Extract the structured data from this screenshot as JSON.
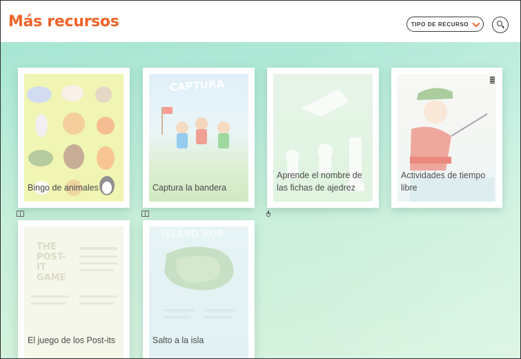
{
  "header": {
    "title": "Más recursos",
    "filter_label": "TIPO DE RECURSO",
    "accent_color": "#f0642a"
  },
  "cards": [
    {
      "label": "Bingo de animales",
      "type_icon": "book-icon"
    },
    {
      "label": "Captura la bandera",
      "type_icon": "book-icon"
    },
    {
      "label": "Aprende el nombre de las fichas de ajedrez",
      "type_icon": "hand-icon"
    },
    {
      "label": "Actividades de tiempo libre",
      "type_icon": "worksheet-icon"
    },
    {
      "label": "El juego de los Post-its",
      "type_icon": "book-icon"
    },
    {
      "label": "Salto a la isla",
      "type_icon": "book-icon"
    }
  ],
  "thumbnail_text": {
    "flag": "CAPTURA",
    "postit_title": "THE POST-IT GAME",
    "island": "ISLAND HOP"
  }
}
